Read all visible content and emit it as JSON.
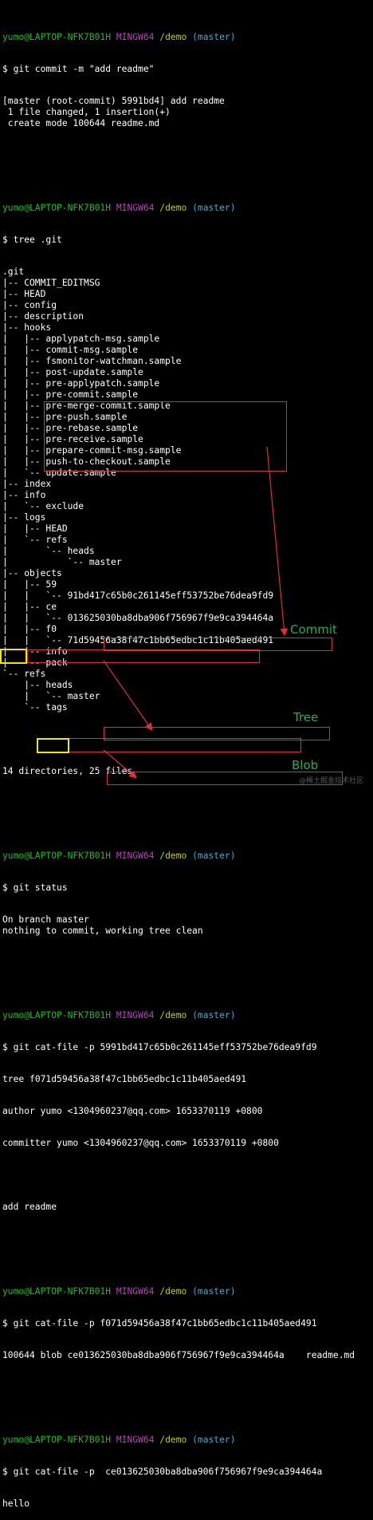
{
  "session": {
    "user_host": "yumo@LAPTOP-NFK7B01H",
    "shell": "MINGW64",
    "path": "/demo",
    "branch": "(master)"
  },
  "commit_block": {
    "command": "$ git commit -m \"add readme\"",
    "output": [
      "[master (root-commit) 5991bd4] add readme",
      " 1 file changed, 1 insertion(+)",
      " create mode 100644 readme.md"
    ]
  },
  "tree_block": {
    "command": "$ tree .git",
    "lines": [
      ".git",
      "|-- COMMIT_EDITMSG",
      "|-- HEAD",
      "|-- config",
      "|-- description",
      "|-- hooks",
      "|   |-- applypatch-msg.sample",
      "|   |-- commit-msg.sample",
      "|   |-- fsmonitor-watchman.sample",
      "|   |-- post-update.sample",
      "|   |-- pre-applypatch.sample",
      "|   |-- pre-commit.sample",
      "|   |-- pre-merge-commit.sample",
      "|   |-- pre-push.sample",
      "|   |-- pre-rebase.sample",
      "|   |-- pre-receive.sample",
      "|   |-- prepare-commit-msg.sample",
      "|   |-- push-to-checkout.sample",
      "|   `-- update.sample",
      "|-- index",
      "|-- info",
      "|   `-- exclude",
      "|-- logs",
      "|   |-- HEAD",
      "|   `-- refs",
      "|       `-- heads",
      "|           `-- master",
      "|-- objects",
      "|   |-- 59",
      "|   |   `-- 91bd417c65b0c261145eff53752be76dea9fd9",
      "|   |-- ce",
      "|   |   `-- 013625030ba8dba906f756967f9e9ca394464a",
      "|   |-- f0",
      "|   |   `-- 71d59456a38f47c1bb65edbc1c11b405aed491",
      "|   |-- info",
      "|   `-- pack",
      "`-- refs",
      "    |-- heads",
      "    |   `-- master",
      "    `-- tags"
    ],
    "summary": "14 directories, 25 files"
  },
  "status_block": {
    "command": "$ git status",
    "output": [
      "On branch master",
      "nothing to commit, working tree clean"
    ]
  },
  "cat_commit": {
    "command_prefix": "$ git cat-file -p ",
    "hash": "5991bd417c65b0c261145eff53752be76dea9fd9",
    "type_word": "tree",
    "tree_hash": " f071d59456a38f47c1bb65edbc1c11b405aed491",
    "author": "author yumo <1304960237@qq.com> 1653370119 +0800",
    "committer": "committer yumo <1304960237@qq.com> 1653370119 +0800",
    "message": "add readme"
  },
  "cat_tree": {
    "command_prefix": "$ git cat-file -p ",
    "hash": "f071d59456a38f47c1bb65edbc1c11b405aed491",
    "mode": "100644 ",
    "type_word": "blob",
    "blob_hash": " ce013625030ba8dba906f756967f9e9ca394464a",
    "filename": "    readme.md"
  },
  "cat_blob": {
    "command_prefix": "$ git cat-file -p  ",
    "hash": "ce013625030ba8dba906f756967f9e9ca394464a",
    "output": "hello"
  },
  "annotations": {
    "commit_label": "Commit",
    "tree_label": "Tree",
    "blob_label": "Blob",
    "watermark": "@稀土掘金技术社区"
  },
  "colors": {
    "prompt_user": "#13c313",
    "prompt_shell": "#c03fc0",
    "prompt_path": "#c8c800",
    "prompt_branch": "#3fa9d5",
    "highlight_box": "#e03030",
    "type_box": "#f2e700",
    "label": "#21b04b"
  }
}
